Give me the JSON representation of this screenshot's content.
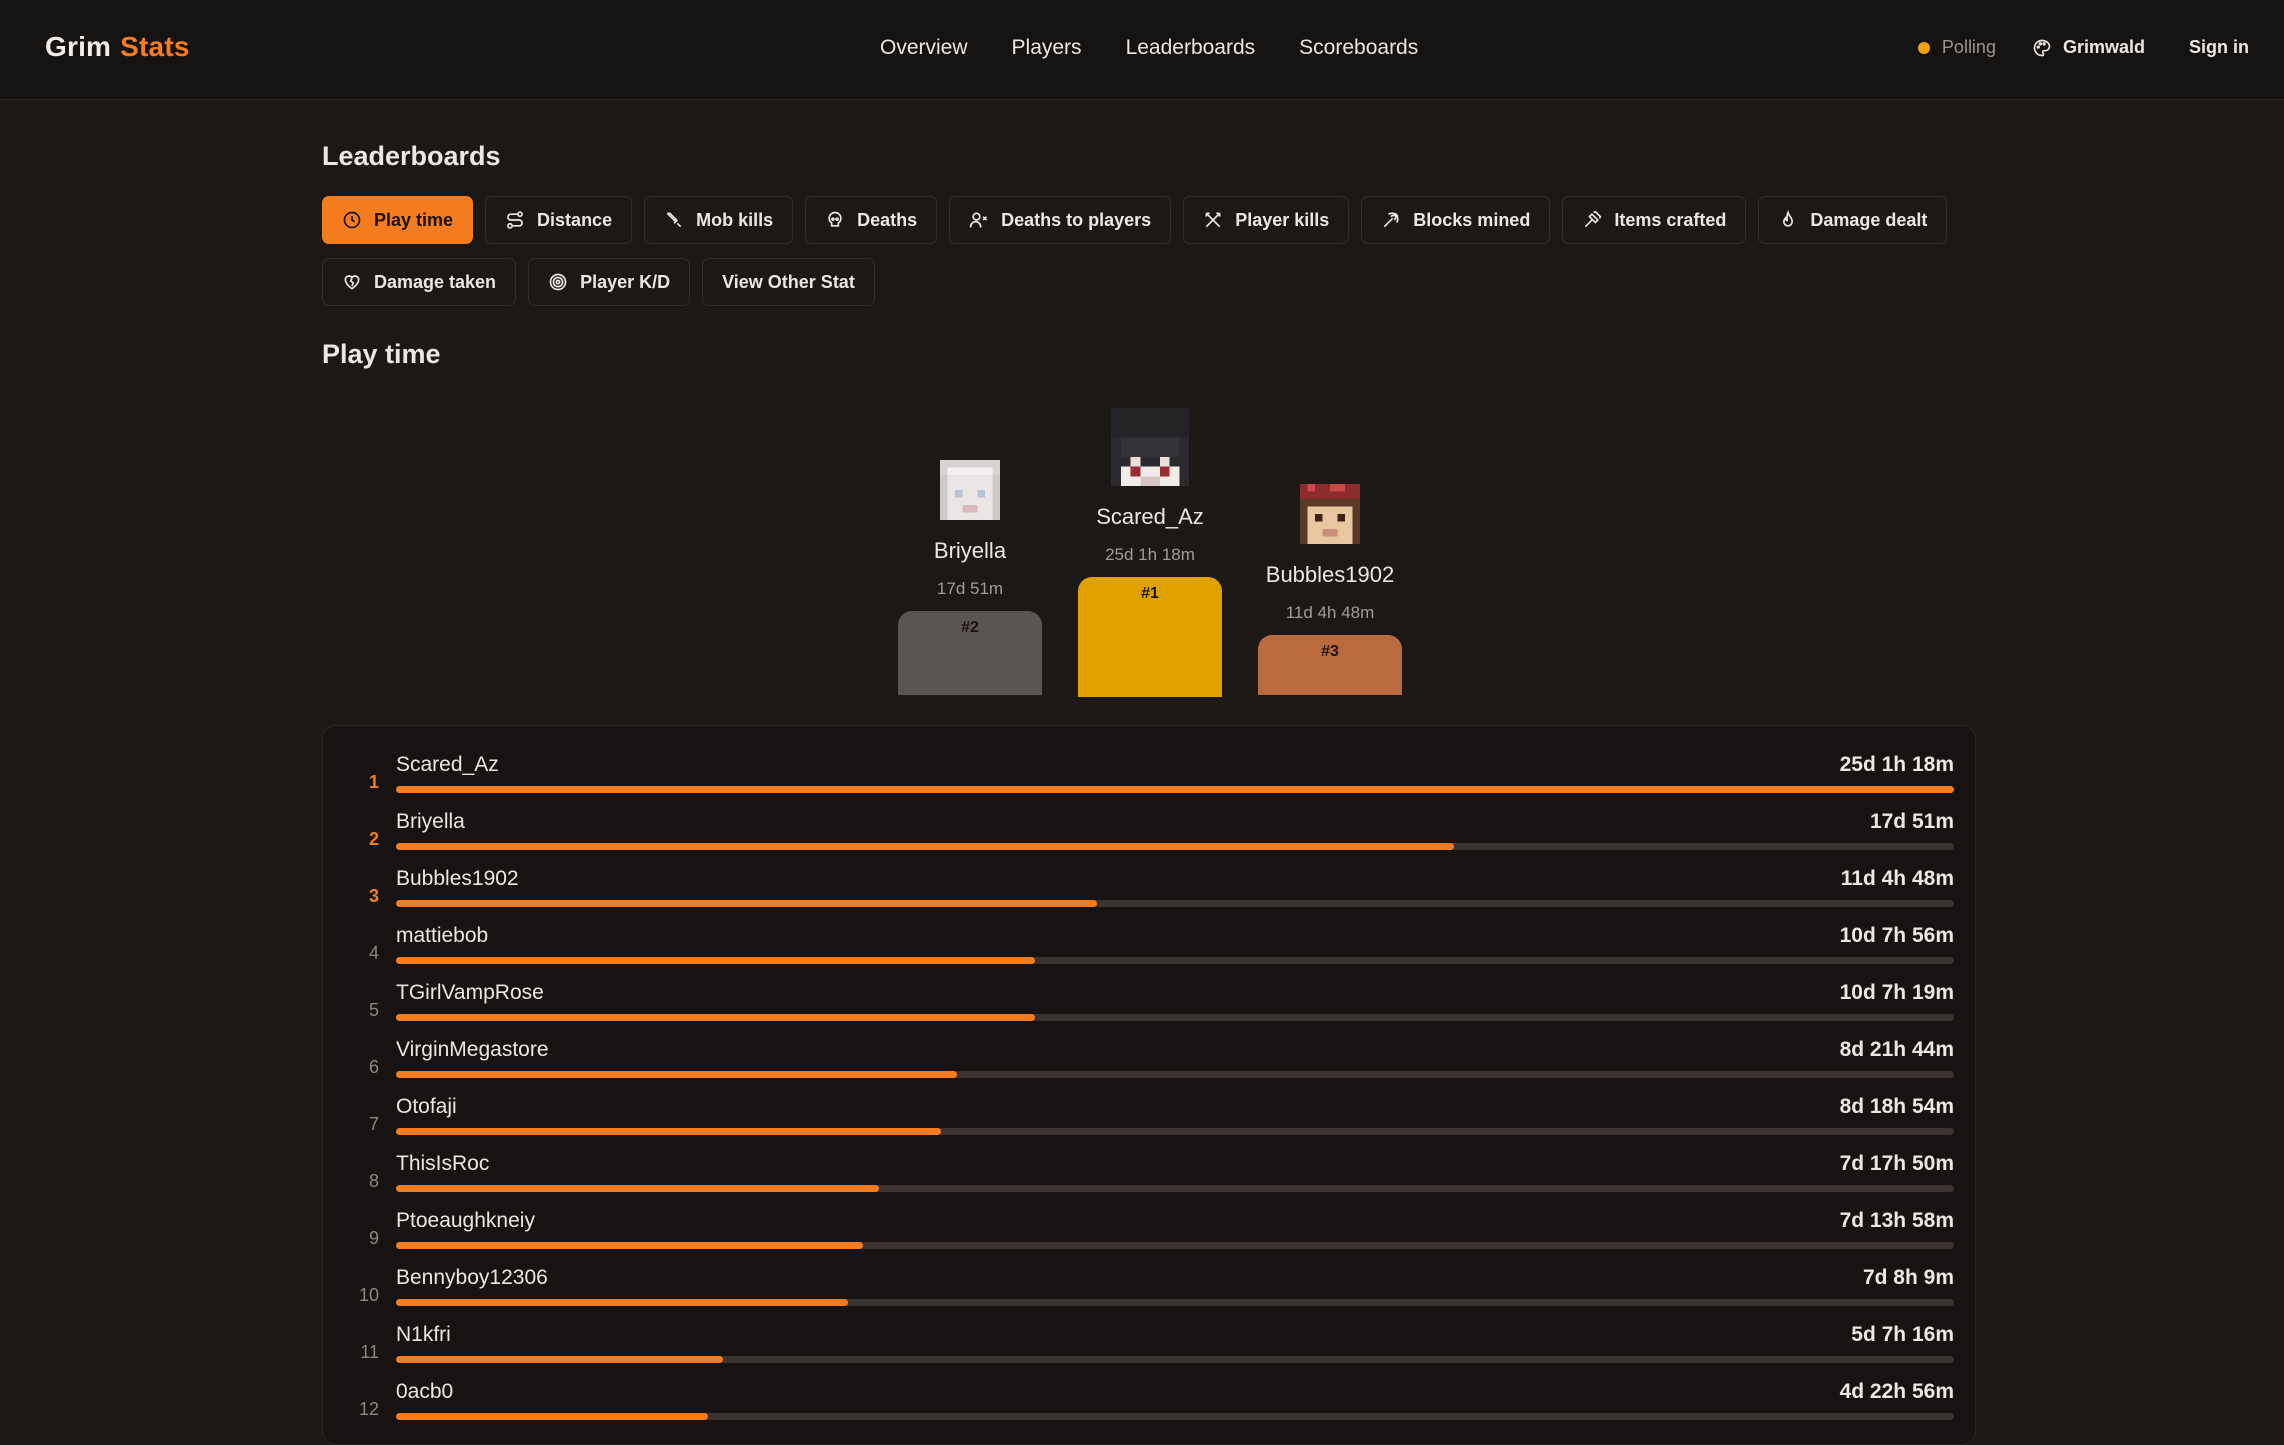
{
  "header": {
    "brand_first": "Grim",
    "brand_second": "Stats",
    "nav": [
      "Overview",
      "Players",
      "Leaderboards",
      "Scoreboards"
    ],
    "status": "Polling",
    "theme": "Grimwald",
    "sign_in": "Sign in"
  },
  "page_title": "Leaderboards",
  "tabs": [
    {
      "label": "Play time",
      "icon": "clock-icon",
      "active": true
    },
    {
      "label": "Distance",
      "icon": "route-icon"
    },
    {
      "label": "Mob kills",
      "icon": "sword-icon"
    },
    {
      "label": "Deaths",
      "icon": "skull-icon"
    },
    {
      "label": "Deaths to players",
      "icon": "user-x-icon"
    },
    {
      "label": "Player kills",
      "icon": "crossed-swords-icon"
    },
    {
      "label": "Blocks mined",
      "icon": "pickaxe-icon"
    },
    {
      "label": "Items crafted",
      "icon": "hammer-icon"
    },
    {
      "label": "Damage dealt",
      "icon": "flame-icon"
    },
    {
      "label": "Damage taken",
      "icon": "heart-crack-icon"
    },
    {
      "label": "Player K/D",
      "icon": "target-icon"
    },
    {
      "label": "View Other Stat",
      "icon": ""
    }
  ],
  "section_title": "Play time",
  "podium": {
    "first": {
      "name": "Scared_Az",
      "value": "25d 1h 18m",
      "badge": "#1"
    },
    "second": {
      "name": "Briyella",
      "value": "17d 51m",
      "badge": "#2"
    },
    "third": {
      "name": "Bubbles1902",
      "value": "11d 4h 48m",
      "badge": "#3"
    }
  },
  "leaderboard": [
    {
      "rank": "1",
      "name": "Scared_Az",
      "value": "25d 1h 18m",
      "fraction": 1.0
    },
    {
      "rank": "2",
      "name": "Briyella",
      "value": "17d 51m",
      "fraction": 0.679
    },
    {
      "rank": "3",
      "name": "Bubbles1902",
      "value": "11d 4h 48m",
      "fraction": 0.45
    },
    {
      "rank": "4",
      "name": "mattiebob",
      "value": "10d 7h 56m",
      "fraction": 0.41
    },
    {
      "rank": "5",
      "name": "TGirlVampRose",
      "value": "10d 7h 19m",
      "fraction": 0.41
    },
    {
      "rank": "6",
      "name": "VirginMegastore",
      "value": "8d 21h 44m",
      "fraction": 0.36
    },
    {
      "rank": "7",
      "name": "Otofaji",
      "value": "8d 18h 54m",
      "fraction": 0.35
    },
    {
      "rank": "8",
      "name": "ThisIsRoc",
      "value": "7d 17h 50m",
      "fraction": 0.31
    },
    {
      "rank": "9",
      "name": "Ptoeaughkneiy",
      "value": "7d 13h 58m",
      "fraction": 0.3
    },
    {
      "rank": "10",
      "name": "Bennyboy12306",
      "value": "7d 8h 9m",
      "fraction": 0.29
    },
    {
      "rank": "11",
      "name": "N1kfri",
      "value": "5d 7h 16m",
      "fraction": 0.21
    },
    {
      "rank": "12",
      "name": "0acb0",
      "value": "4d 22h 56m",
      "fraction": 0.2
    }
  ],
  "colors": {
    "accent": "#f57c1f",
    "gold": "#e0a100",
    "silver": "#5a5552",
    "bronze": "#b96b3f",
    "track": "#3a332f"
  }
}
